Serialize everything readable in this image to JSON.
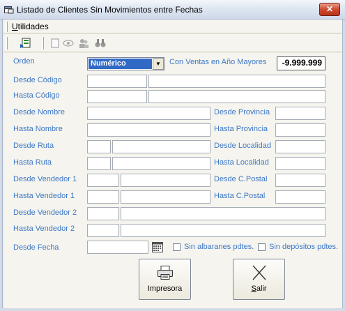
{
  "window": {
    "title": "Listado de Clientes Sin Movimientos entre Fechas",
    "close_glyph": "✕"
  },
  "menu": {
    "items": [
      {
        "label": "Utilidades"
      }
    ]
  },
  "toolbar": {
    "icons": [
      "run-icon",
      "page-icon",
      "view-icon",
      "people-icon",
      "binoculars-icon"
    ]
  },
  "form": {
    "orden_label": "Orden",
    "orden_value": "Numérico",
    "ventas_label": "Con Ventas en Año Mayores",
    "ventas_value": "-9.999.999",
    "desde_codigo_label": "Desde Código",
    "hasta_codigo_label": "Hasta Código",
    "desde_nombre_label": "Desde Nombre",
    "hasta_nombre_label": "Hasta Nombre",
    "desde_ruta_label": "Desde Ruta",
    "hasta_ruta_label": "Hasta Ruta",
    "desde_vendedor1_label": "Desde Vendedor 1",
    "hasta_vendedor1_label": "Hasta Vendedor 1",
    "desde_vendedor2_label": "Desde Vendedor 2",
    "hasta_vendedor2_label": "Hasta Vendedor 2",
    "desde_fecha_label": "Desde Fecha",
    "desde_provincia_label": "Desde Provincia",
    "hasta_provincia_label": "Hasta Provincia",
    "desde_localidad_label": "Desde Localidad",
    "hasta_localidad_label": "Hasta Localidad",
    "desde_cpostal_label": "Desde C.Postal",
    "hasta_cpostal_label": "Hasta C.Postal",
    "sin_albaranes_label": "Sin albaranes pdtes.",
    "sin_depositos_label": "Sin depósitos pdtes."
  },
  "buttons": {
    "impresora_label": "Impresora",
    "salir_label": "Salir"
  },
  "colors": {
    "label_blue": "#3d78c7",
    "selection_blue": "#316ac5"
  }
}
